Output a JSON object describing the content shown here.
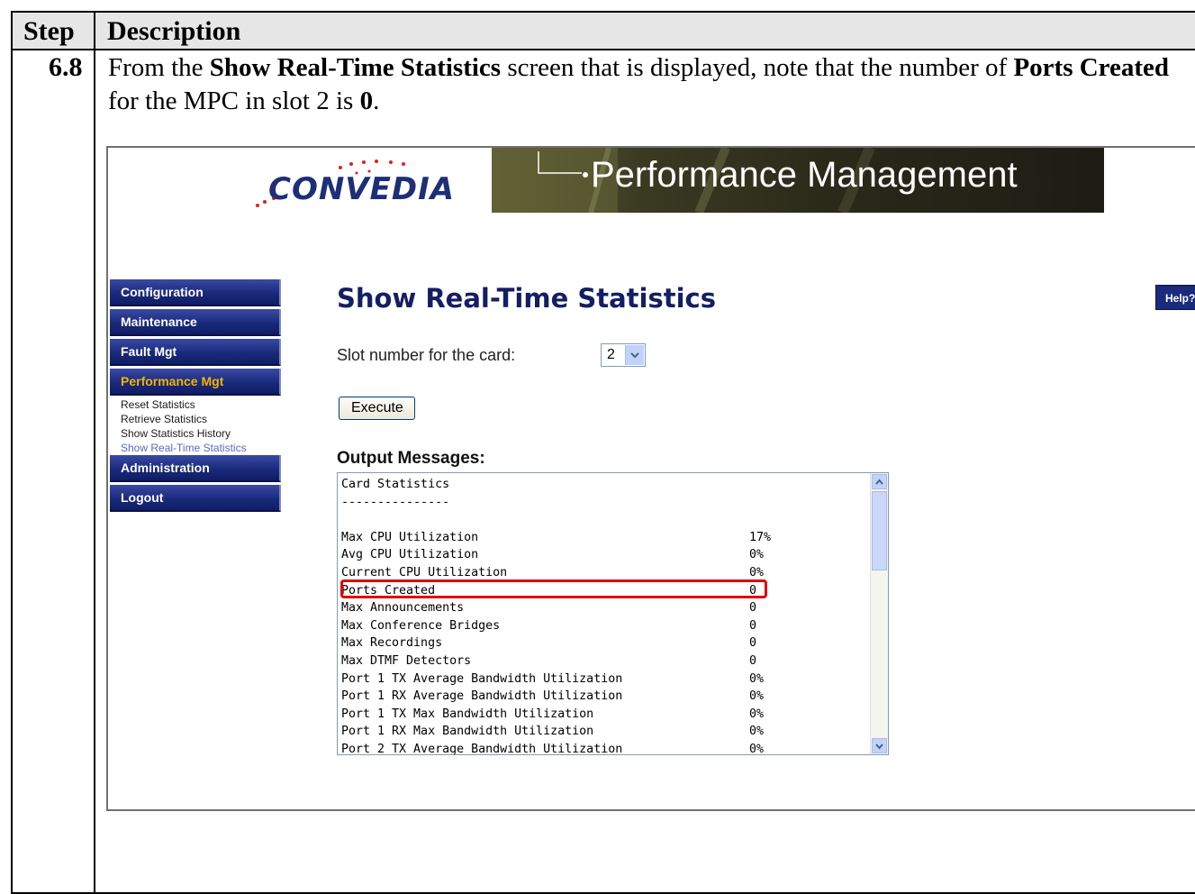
{
  "doc": {
    "header_step": "Step",
    "header_description": "Description",
    "step_number": "6.8",
    "desc_part1": "From the ",
    "desc_bold1": "Show Real-Time Statistics",
    "desc_part2": " screen that is displayed, note that the number of ",
    "desc_bold2": "Ports Created",
    "desc_part3": " for the MPC in slot 2 is ",
    "desc_bold3": "0",
    "desc_part4": "."
  },
  "app": {
    "logo": "CONVEDIA",
    "banner_title": "Performance Management"
  },
  "nav": {
    "items": [
      {
        "label": "Configuration"
      },
      {
        "label": "Maintenance"
      },
      {
        "label": "Fault Mgt"
      },
      {
        "label": "Performance Mgt"
      },
      {
        "label": "Administration"
      },
      {
        "label": "Logout"
      }
    ],
    "sub_items": [
      {
        "label": "Reset Statistics"
      },
      {
        "label": "Retrieve Statistics"
      },
      {
        "label": "Show Statistics History"
      },
      {
        "label": "Show Real-Time Statistics"
      }
    ]
  },
  "main": {
    "title": "Show Real-Time Statistics",
    "help_label": "Help?",
    "slot_label": "Slot number for the card:",
    "slot_value": "2",
    "execute_label": "Execute",
    "output_label": "Output Messages:",
    "output_lines": [
      {
        "label": "Card Statistics",
        "value": ""
      },
      {
        "label": "---------------",
        "value": ""
      },
      {
        "label": "",
        "value": ""
      },
      {
        "label": "Max CPU Utilization",
        "value": "17%"
      },
      {
        "label": "Avg CPU Utilization",
        "value": "0%"
      },
      {
        "label": "Current CPU Utilization",
        "value": "0%"
      },
      {
        "label": "Ports Created",
        "value": "0"
      },
      {
        "label": "Max Announcements",
        "value": "0"
      },
      {
        "label": "Max Conference Bridges",
        "value": "0"
      },
      {
        "label": "Max Recordings",
        "value": "0"
      },
      {
        "label": "Max DTMF Detectors",
        "value": "0"
      },
      {
        "label": "Port 1 TX Average Bandwidth Utilization",
        "value": "0%"
      },
      {
        "label": "Port 1 RX Average Bandwidth Utilization",
        "value": "0%"
      },
      {
        "label": "Port 1 TX Max Bandwidth Utilization",
        "value": "0%"
      },
      {
        "label": "Port 1 RX Max Bandwidth Utilization",
        "value": "0%"
      },
      {
        "label": "Port 2 TX Average Bandwidth Utilization",
        "value": "0%"
      }
    ]
  },
  "colors": {
    "nav_bg": "#1a2a7c",
    "nav_active_text": "#f5b300",
    "title_color": "#141e64",
    "highlight": "#e00000"
  }
}
